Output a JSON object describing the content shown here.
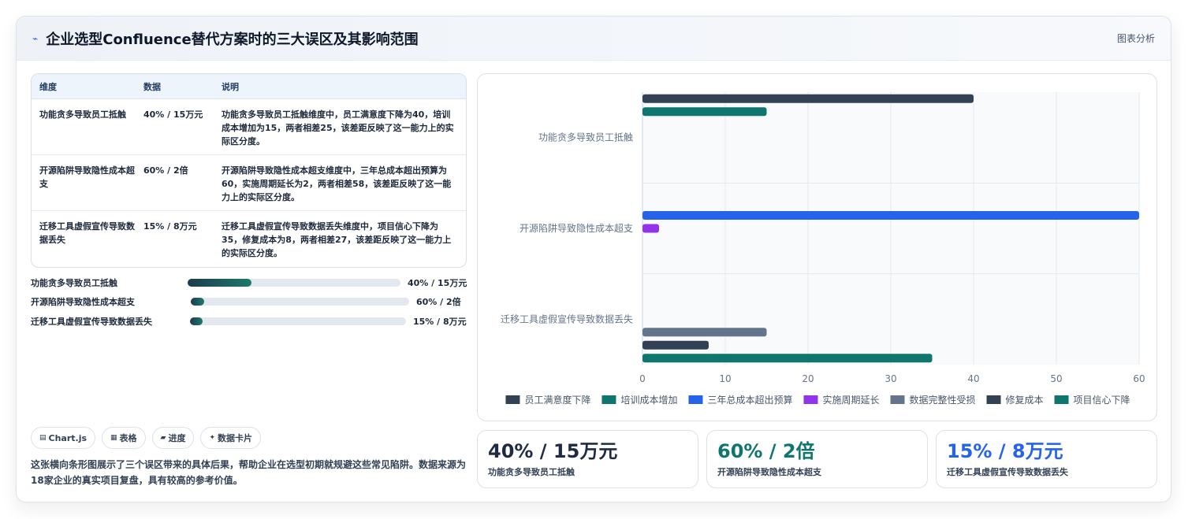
{
  "header": {
    "icon": "⌁",
    "title": "企业选型Confluence替代方案时的三大误区及其影响范围",
    "tag": "图表分析"
  },
  "table": {
    "headers": [
      "维度",
      "数据",
      "说明"
    ],
    "rows": [
      {
        "dim": "功能贪多导致员工抵触",
        "data": "40% / 15万元",
        "note": "功能贪多导致员工抵触维度中，员工满意度下降为40，培训成本增加为15，两者相差25，该差距反映了这一能力上的实际区分度。"
      },
      {
        "dim": "开源陷阱导致隐性成本超支",
        "data": "60% / 2倍",
        "note": "开源陷阱导致隐性成本超支维度中，三年总成本超出预算为60，实施周期延长为2，两者相差58，该差距反映了这一能力上的实际区分度。"
      },
      {
        "dim": "迁移工具虚假宣传导致数据丢失",
        "data": "15% / 8万元",
        "note": "迁移工具虚假宣传导致数据丢失维度中，项目信心下降为35，修复成本为8，两者相差27，该差距反映了这一能力上的实际区分度。"
      }
    ]
  },
  "progress": [
    {
      "label": "功能贪多导致员工抵触",
      "value": "40% / 15万元",
      "fraction": 0.3
    },
    {
      "label": "开源陷阱导致隐性成本超支",
      "value": "60% / 2倍",
      "fraction": 0.06
    },
    {
      "label": "迁移工具虚假宣传导致数据丢失",
      "value": "15% / 8万元",
      "fraction": 0.06
    }
  ],
  "pills": [
    {
      "icon": "▤",
      "label": "Chart.js"
    },
    {
      "icon": "▦",
      "label": "表格"
    },
    {
      "icon": "▰",
      "label": "进度"
    },
    {
      "icon": "✦",
      "label": "数据卡片"
    }
  ],
  "description": "这张横向条形图展示了三个误区带来的具体后果，帮助企业在选型初期就规避这些常见陷阱。数据来源为18家企业的真实项目复盘，具有较高的参考价值。",
  "kpis": [
    {
      "value": "40% / 15万元",
      "label": "功能贪多导致员工抵触",
      "color": "#1f2a44"
    },
    {
      "value": "60% / 2倍",
      "label": "开源陷阱导致隐性成本超支",
      "color": "#0f766e"
    },
    {
      "value": "15% / 8万元",
      "label": "迁移工具虚假宣传导致数据丢失",
      "color": "#2563eb"
    }
  ],
  "chart_data": {
    "type": "bar",
    "orientation": "horizontal",
    "categories": [
      "功能贪多导致员工抵触",
      "开源陷阱导致隐性成本超支",
      "迁移工具虚假宣传导致数据丢失"
    ],
    "xlim": [
      0,
      60
    ],
    "xticks": [
      0,
      10,
      20,
      30,
      40,
      50,
      60
    ],
    "grid": true,
    "legend_position": "bottom",
    "series": [
      {
        "name": "员工满意度下降",
        "color": "#334155",
        "values": [
          40,
          null,
          null
        ]
      },
      {
        "name": "培训成本增加",
        "color": "#0f766e",
        "values": [
          15,
          null,
          null
        ]
      },
      {
        "name": "三年总成本超出预算",
        "color": "#2563eb",
        "values": [
          null,
          60,
          null
        ]
      },
      {
        "name": "实施周期延长",
        "color": "#9333ea",
        "values": [
          null,
          2,
          null
        ]
      },
      {
        "name": "数据完整性受损",
        "color": "#64748b",
        "values": [
          null,
          null,
          15
        ]
      },
      {
        "name": "修复成本",
        "color": "#334155",
        "values": [
          null,
          null,
          8
        ]
      },
      {
        "name": "项目信心下降",
        "color": "#0f766e",
        "values": [
          null,
          null,
          35
        ]
      }
    ]
  }
}
